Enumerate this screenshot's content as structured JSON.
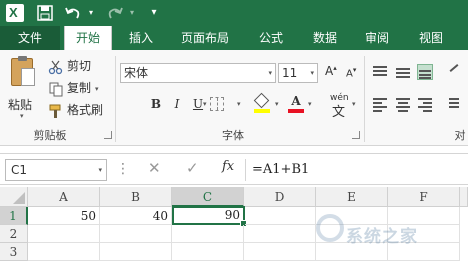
{
  "qat": {
    "undo_dropdown": "▾",
    "redo_dropdown": "▾",
    "customize": "▾"
  },
  "tabs": [
    {
      "label": "文件"
    },
    {
      "label": "开始"
    },
    {
      "label": "插入"
    },
    {
      "label": "页面布局"
    },
    {
      "label": "公式"
    },
    {
      "label": "数据"
    },
    {
      "label": "审阅"
    },
    {
      "label": "视图"
    }
  ],
  "ribbon": {
    "clipboard": {
      "paste_label": "粘贴",
      "cut_label": "剪切",
      "copy_label": "复制",
      "format_painter_label": "格式刷",
      "group_label": "剪贴板"
    },
    "font": {
      "font_name": "宋体",
      "font_size": "11",
      "grow_label": "A",
      "shrink_label": "A",
      "bold_label": "B",
      "italic_label": "I",
      "underline_label": "U",
      "font_color_label": "A",
      "phonetic_top": "wén",
      "phonetic_bottom": "文",
      "group_label": "字体",
      "fill_color": "#ffff00",
      "font_color": "#e81123"
    },
    "alignment": {
      "group_label": "对"
    }
  },
  "formula_bar": {
    "name_box": "C1",
    "formula": "=A1+B1"
  },
  "sheet": {
    "columns": [
      "A",
      "B",
      "C",
      "D",
      "E",
      "F"
    ],
    "rows": [
      "1",
      "2",
      "3"
    ],
    "cells": {
      "A1": "50",
      "B1": "40",
      "C1": "90"
    }
  },
  "watermark": {
    "text": "系统之家"
  },
  "colors": {
    "accent": "#217346"
  }
}
